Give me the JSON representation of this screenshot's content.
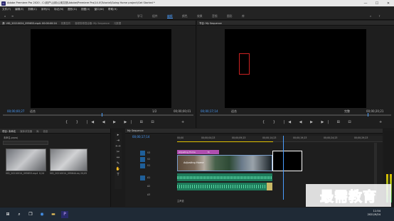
{
  "window": {
    "title": "Adobe Premiere Pro 2020 - C:\\用户\\公用\\公用文档\\Adobe\\Premiere Pro\\14.0\\Tutorial\\Going Home project\\Get Started *",
    "logo": "Pr",
    "minimize": "—",
    "maximize": "☐",
    "close": "✕"
  },
  "menu": [
    "文件(F)",
    "编辑(E)",
    "剪辑(C)",
    "序列(S)",
    "标记(M)",
    "图形(G)",
    "视图(V)",
    "窗口(W)",
    "帮助(H)"
  ],
  "workspaces": [
    "学习",
    "组件",
    "编辑",
    "颜色",
    "效果",
    "音频",
    "图形",
    "库"
  ],
  "source": {
    "tabs": [
      "源: VID_20210024_095653.mp4: 00:00:00:24",
      "效果控件",
      "音频剪辑混合器: My Sequence",
      "元数据"
    ],
    "timecode": "00;00;00;27",
    "fit": "适合",
    "scale": "1/2",
    "duration": "00;00;00;01"
  },
  "program": {
    "tabs": [
      "节目: My Sequence"
    ],
    "timecode": "00;00;17;14",
    "fit": "适合",
    "scale": "完整",
    "duration": "00;00;20;21"
  },
  "project": {
    "tabs": [
      "项目: 未命名",
      "媒体浏览器",
      "库",
      "信息",
      "效果",
      "标记"
    ],
    "name": "未命名.prproj",
    "items": [
      {
        "name": "VID_20210024_095653.mp4",
        "duration": "0;24"
      },
      {
        "name": "VID_20210024_095644.mp4",
        "duration": "20;05"
      }
    ]
  },
  "timeline": {
    "tab": "My Sequence",
    "timecode": "00;00;17;14",
    "ruler": [
      "00;00",
      "00;00;04;23",
      "00;00;09;23",
      "00;00;14;23",
      "00;00;19;23",
      "00;00;24;23",
      "00;00;29;23"
    ],
    "video_tracks": [
      "V3",
      "V2",
      "V1"
    ],
    "audio_tracks": [
      "A1",
      "A2",
      "A3"
    ],
    "clip_labels": {
      "fx": "fx",
      "adj": "Adjusting Home",
      "video_a": "Adjusting Home",
      "mix": "主声道"
    }
  },
  "watermark": "最需教育",
  "taskbar": {
    "time": "11:54",
    "date": "2021/9/24"
  }
}
